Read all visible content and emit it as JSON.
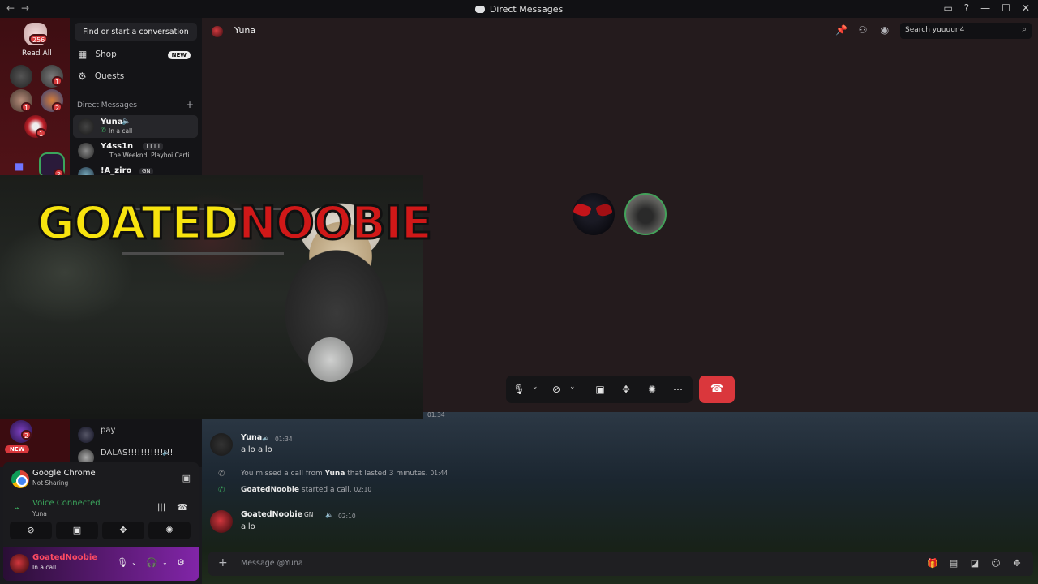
{
  "window": {
    "title": "Direct Messages"
  },
  "server_rail": {
    "home_badge": "256",
    "read_all_label": "Read All",
    "badges": [
      "1",
      "1",
      "1",
      "2",
      "1",
      "2",
      "2"
    ],
    "new_label": "NEW"
  },
  "dm_sidebar": {
    "find_placeholder": "Find or start a conversation",
    "shop_label": "Shop",
    "shop_badge": "NEW",
    "quests_label": "Quests",
    "section_header": "Direct Messages",
    "dms": [
      {
        "name": "Yuna",
        "status": "In a call"
      },
      {
        "name": "Y4ss1n",
        "tag": "1111",
        "status": "The Weeknd, Playboi Carti"
      },
      {
        "name": "!A_ziro",
        "tag": "GN"
      }
    ],
    "lower_dms": [
      {
        "name": "pay"
      },
      {
        "name": "DALAS!!!!!!!!!!!!!!"
      }
    ]
  },
  "channel": {
    "name": "Yuna",
    "search_placeholder": "Search yuuuun4"
  },
  "messages": [
    {
      "author": "Yuna",
      "time": "01:34",
      "text": "allo allo",
      "prev_time": "01:34"
    },
    {
      "system": "missed",
      "prefix": "You missed a call from ",
      "who": "Yuna",
      "suffix": " that lasted 3 minutes.",
      "time": "01:44"
    },
    {
      "system": "started",
      "who": "GoatedNoobie",
      "suffix": " started a call.",
      "time": "02:10"
    },
    {
      "author": "GoatedNoobie",
      "tag": "GN",
      "time": "02:10",
      "text": "allo"
    }
  ],
  "composer": {
    "placeholder": "Message @Yuna"
  },
  "bottom_panel": {
    "app_name": "Google Chrome",
    "app_status": "Not Sharing",
    "voice_title": "Voice Connected",
    "voice_channel": "Yuna",
    "user_name": "GoatedNoobie",
    "user_status": "In a call"
  },
  "overlay": {
    "logo_part1": "GOATED",
    "logo_part2": "NOOBIE"
  },
  "colors": {
    "accent_red": "#da373c",
    "voice_green": "#3ba55c",
    "brand_name": "#ff4b62"
  }
}
